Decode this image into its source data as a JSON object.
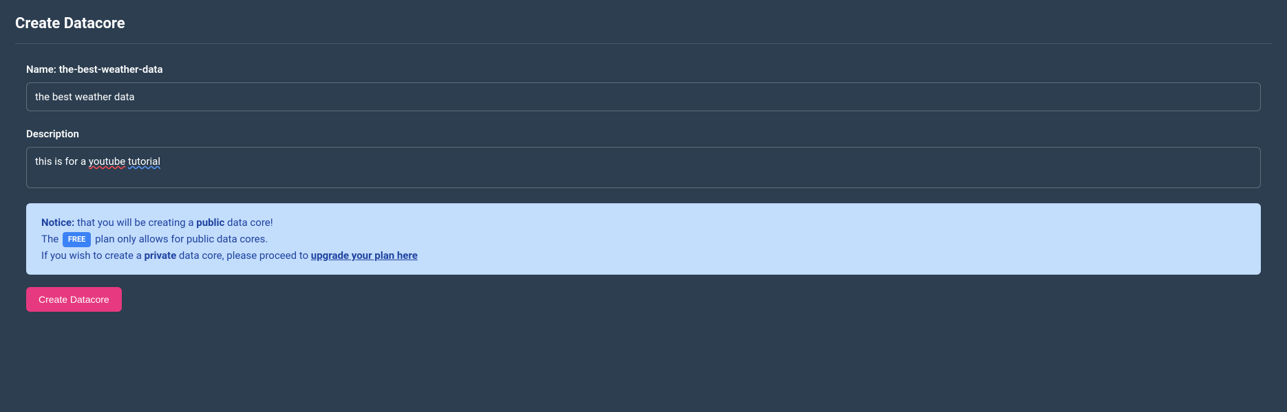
{
  "page": {
    "title": "Create Datacore"
  },
  "form": {
    "name_label_prefix": "Name: ",
    "name_slug": "the-best-weather-data",
    "name_value": "the best weather data",
    "description_label": "Description",
    "description_value": "this is for a youtube tutorial",
    "description_words": {
      "prefix": "this is for a ",
      "word1": "youtube",
      "space": " ",
      "word2": "tutorial"
    }
  },
  "notice": {
    "prefix": "Notice:",
    "line1_a": " that you will be creating a ",
    "line1_bold": "public",
    "line1_b": " data core!",
    "line2_a": "The ",
    "badge": "FREE",
    "line2_b": " plan only allows for public data cores.",
    "line3_a": "If you wish to create a ",
    "line3_bold": "private",
    "line3_b": " data core, please proceed to ",
    "link_text": "upgrade your plan here"
  },
  "actions": {
    "create_label": "Create Datacore"
  }
}
